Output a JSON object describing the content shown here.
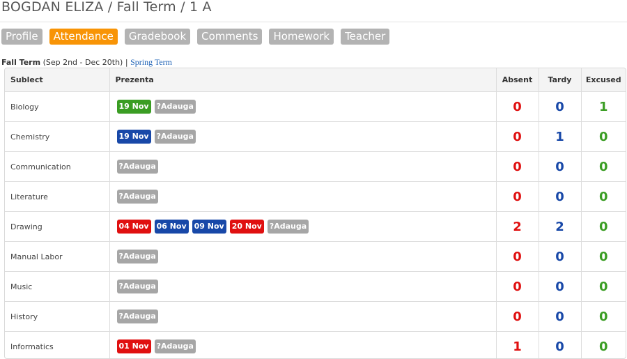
{
  "header": {
    "title": "BOGDAN ELIZA / Fall Term / 1 A"
  },
  "tabs": [
    {
      "label": "Profile",
      "active": false
    },
    {
      "label": "Attendance",
      "active": true
    },
    {
      "label": "Gradebook",
      "active": false
    },
    {
      "label": "Comments",
      "active": false
    },
    {
      "label": "Homework",
      "active": false
    },
    {
      "label": "Teacher",
      "active": false
    }
  ],
  "term": {
    "current": "Fall Term",
    "range": "(Sep 2nd - Dec 20th)",
    "separator": "|",
    "other_link": "Spring Term"
  },
  "table": {
    "headers": {
      "subject": "Sublect",
      "presence": "Prezenta",
      "absent": "Absent",
      "tardy": "Tardy",
      "excused": "Excused"
    },
    "rows": [
      {
        "subject": "Biology",
        "badges": [
          {
            "text": "19 Nov",
            "color": "green"
          },
          {
            "text": "?Adauga",
            "color": "grey"
          }
        ],
        "absent": "0",
        "tardy": "0",
        "excused": "1"
      },
      {
        "subject": "Chemistry",
        "badges": [
          {
            "text": "19 Nov",
            "color": "blue"
          },
          {
            "text": "?Adauga",
            "color": "grey"
          }
        ],
        "absent": "0",
        "tardy": "1",
        "excused": "0"
      },
      {
        "subject": "Communication",
        "badges": [
          {
            "text": "?Adauga",
            "color": "grey"
          }
        ],
        "absent": "0",
        "tardy": "0",
        "excused": "0"
      },
      {
        "subject": "Literature",
        "badges": [
          {
            "text": "?Adauga",
            "color": "grey"
          }
        ],
        "absent": "0",
        "tardy": "0",
        "excused": "0"
      },
      {
        "subject": "Drawing",
        "badges": [
          {
            "text": "04 Nov",
            "color": "red"
          },
          {
            "text": "06 Nov",
            "color": "blue"
          },
          {
            "text": "09 Nov",
            "color": "blue"
          },
          {
            "text": "20 Nov",
            "color": "red"
          },
          {
            "text": "?Adauga",
            "color": "grey"
          }
        ],
        "absent": "2",
        "tardy": "2",
        "excused": "0"
      },
      {
        "subject": "Manual Labor",
        "badges": [
          {
            "text": "?Adauga",
            "color": "grey"
          }
        ],
        "absent": "0",
        "tardy": "0",
        "excused": "0"
      },
      {
        "subject": "Music",
        "badges": [
          {
            "text": "?Adauga",
            "color": "grey"
          }
        ],
        "absent": "0",
        "tardy": "0",
        "excused": "0"
      },
      {
        "subject": "History",
        "badges": [
          {
            "text": "?Adauga",
            "color": "grey"
          }
        ],
        "absent": "0",
        "tardy": "0",
        "excused": "0"
      },
      {
        "subject": "Informatics",
        "badges": [
          {
            "text": "01 Nov",
            "color": "red"
          },
          {
            "text": "?Adauga",
            "color": "grey"
          }
        ],
        "absent": "1",
        "tardy": "0",
        "excused": "0"
      }
    ]
  },
  "colors": {
    "accent_tab": "#f89406",
    "absent": "#e01010",
    "tardy": "#1848a8",
    "excused": "#3a9d23",
    "add_badge": "#a6a6a6"
  }
}
